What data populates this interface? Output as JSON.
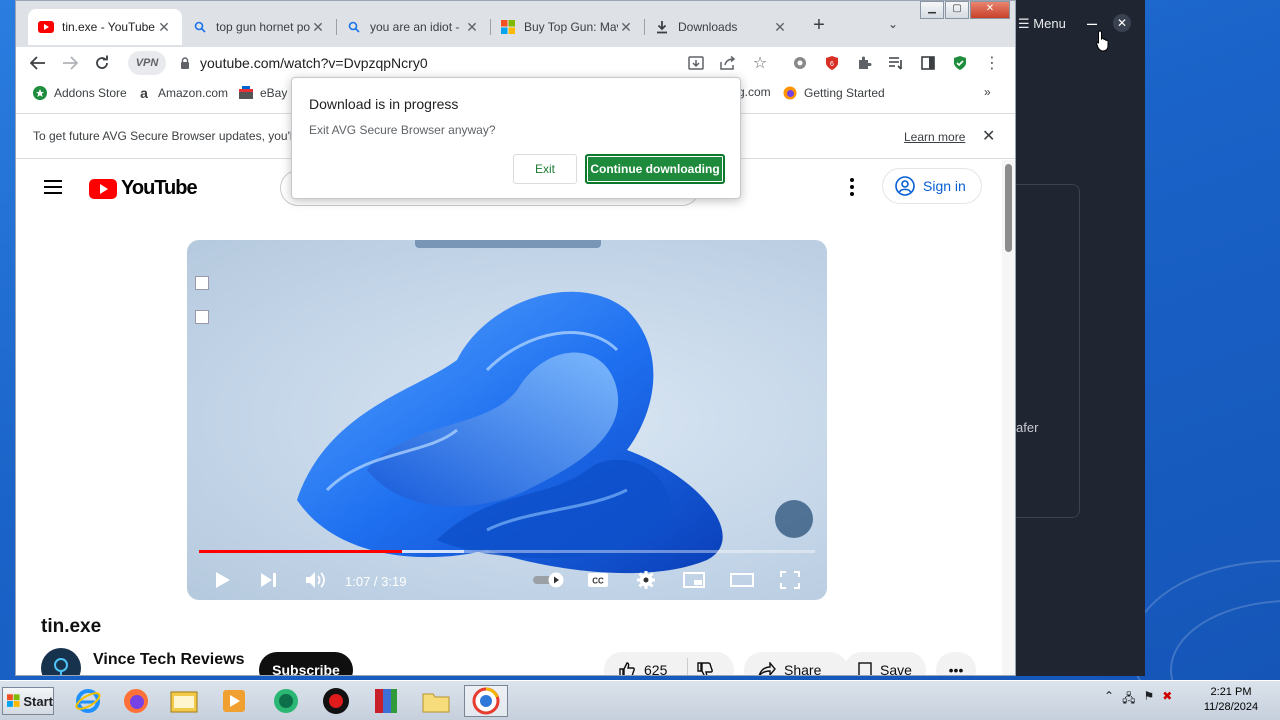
{
  "tabs": [
    {
      "label": "tin.exe - YouTube",
      "active": true,
      "icon": "youtube-icon"
    },
    {
      "label": "top gun hornet po",
      "active": false,
      "icon": "search-icon"
    },
    {
      "label": "you are an idiot - ",
      "active": false,
      "icon": "search-icon"
    },
    {
      "label": "Buy Top Gun: Mav",
      "active": false,
      "icon": "microsoft-icon"
    },
    {
      "label": "Downloads",
      "active": false,
      "icon": "download-icon"
    }
  ],
  "toolbar": {
    "vpn_label": "VPN",
    "url": "youtube.com/watch?v=DvpzqpNcry0"
  },
  "bookmarks": [
    {
      "label": "Addons Store"
    },
    {
      "label": "Amazon.com"
    },
    {
      "label": "eBay"
    },
    {
      "label": "g.com"
    },
    {
      "label": "Getting Started"
    }
  ],
  "infobar": {
    "message": "To get future AVG Secure Browser updates, you'l",
    "learn_more": "Learn more"
  },
  "dialog": {
    "title": "Download is in progress",
    "message": "Exit AVG Secure Browser anyway?",
    "exit_label": "Exit",
    "continue_label": "Continue downloading"
  },
  "youtube": {
    "logo_text": "YouTube",
    "sign_in": "Sign in",
    "player": {
      "time": "1:07 / 3:19",
      "played_fraction": 0.33,
      "buffered_fraction": 0.43
    },
    "video_title": "tin.exe",
    "channel_name": "Vince Tech Reviews",
    "subscribe": "Subscribe",
    "like_count": "625",
    "share": "Share",
    "save": "Save"
  },
  "background_app": {
    "menu_label": "Menu",
    "partial_text": "afer"
  },
  "taskbar": {
    "start_label": "Start",
    "time": "2:21 PM",
    "date": "11/28/2024"
  },
  "colors": {
    "youtube_red": "#ff0000",
    "avg_green": "#1e8a3c",
    "link_blue": "#065fd4"
  }
}
